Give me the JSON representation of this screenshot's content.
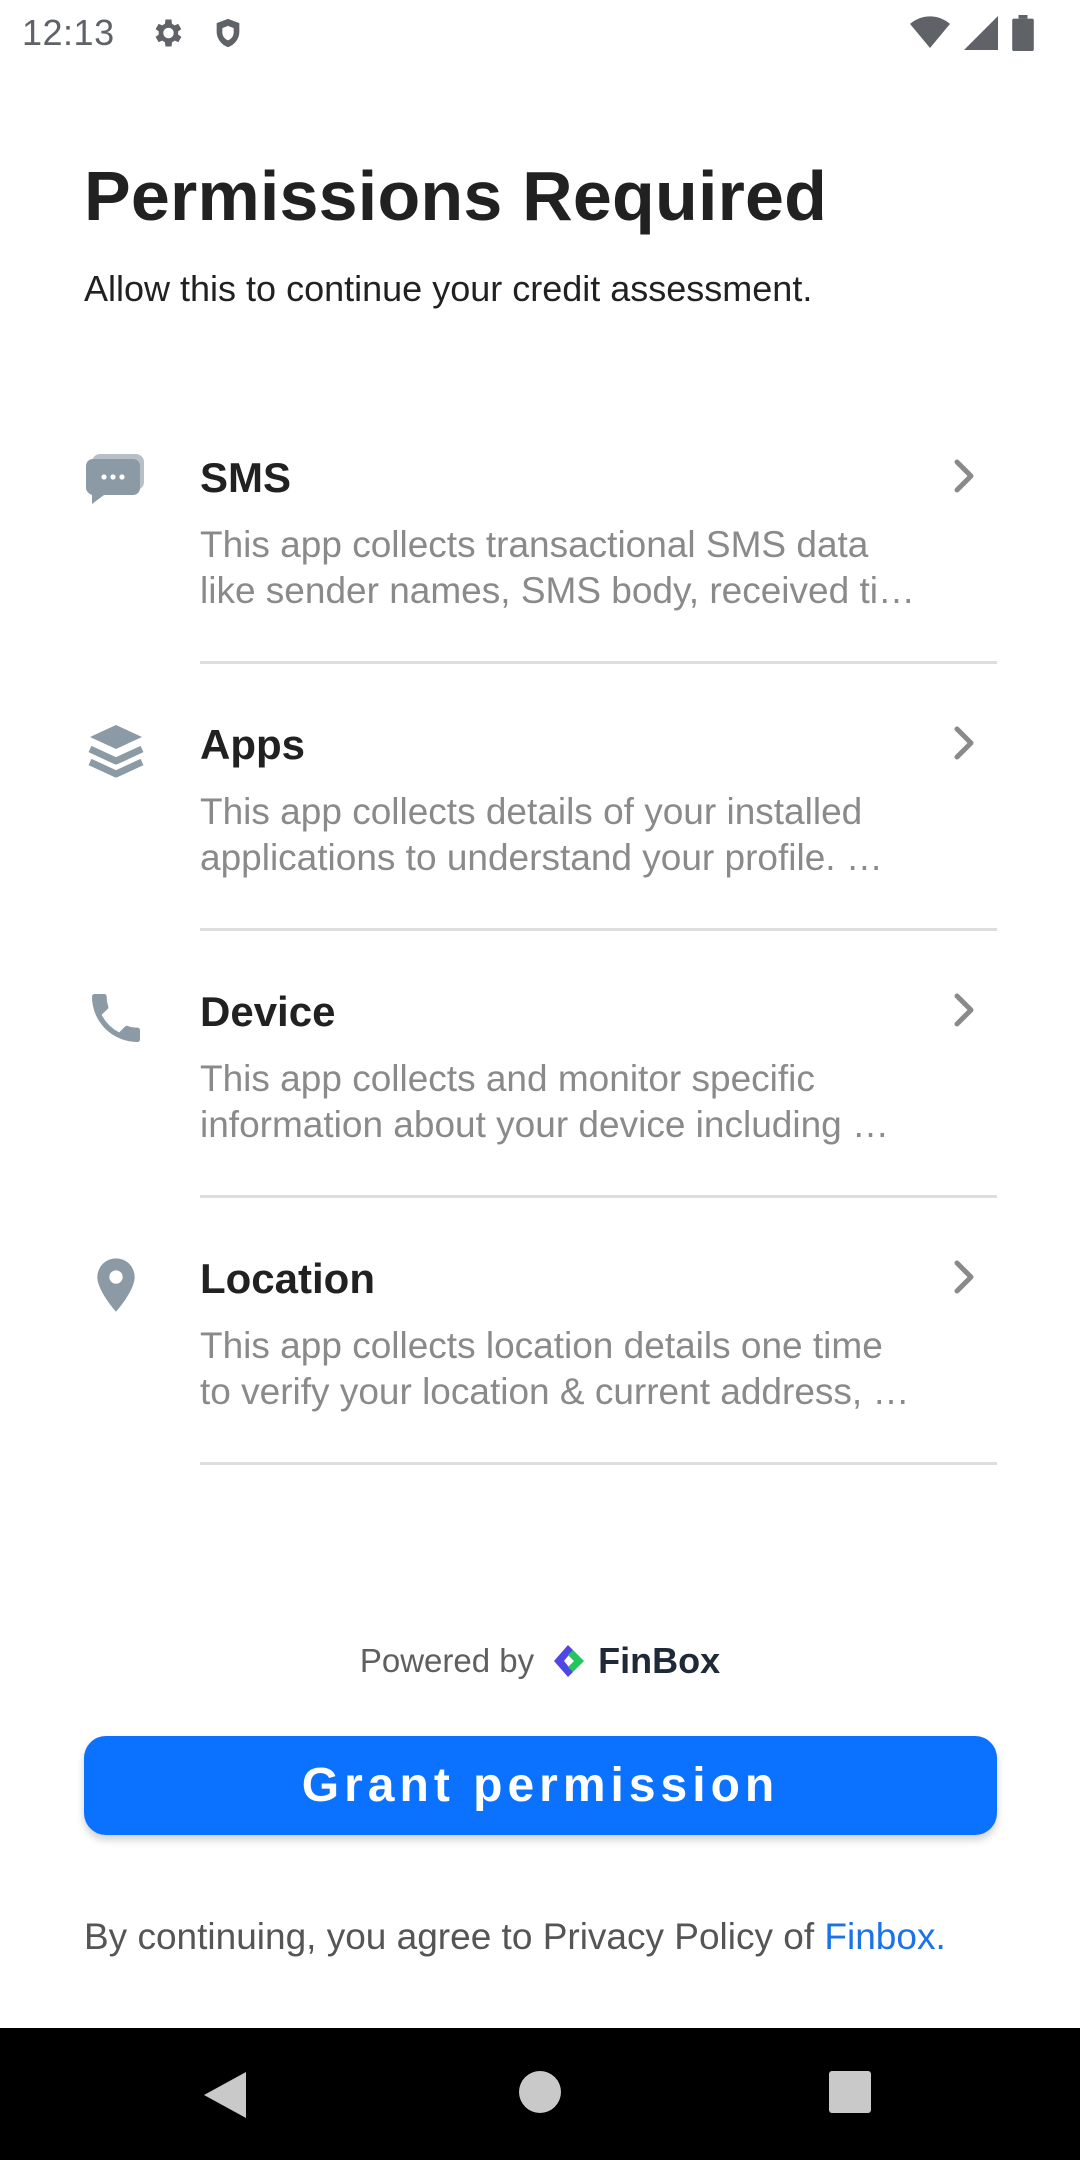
{
  "status_bar": {
    "time": "12:13",
    "icons": [
      "gear-icon",
      "shield-icon",
      "wifi-icon",
      "signal-icon",
      "battery-icon"
    ]
  },
  "header": {
    "title": "Permissions Required",
    "subtitle": "Allow this to continue your credit assessment."
  },
  "permissions": [
    {
      "title": "SMS",
      "icon": "chat-bubble-icon",
      "desc_line1": "This app collects transactional SMS data",
      "desc_line2": "like sender names, SMS body, received ti…"
    },
    {
      "title": "Apps",
      "icon": "layers-icon",
      "desc_line1": "This app collects details of your installed",
      "desc_line2": "applications to understand your profile. …"
    },
    {
      "title": "Device",
      "icon": "phone-icon",
      "desc_line1": "This app collects and monitor specific",
      "desc_line2": "information about your device including …"
    },
    {
      "title": "Location",
      "icon": "location-pin-icon",
      "desc_line1": "This app collects location details one time",
      "desc_line2": "to verify your location & current address, …"
    }
  ],
  "powered_by": {
    "label": "Powered by",
    "brand": "FinBox"
  },
  "grant_button": {
    "label": "Grant permission"
  },
  "agreement": {
    "text": "By continuing, you agree to Privacy Policy of ",
    "link": "Finbox."
  },
  "colors": {
    "primary": "#0a72ff",
    "icon_gray": "#8c9aa5",
    "link": "#1a73e8"
  }
}
